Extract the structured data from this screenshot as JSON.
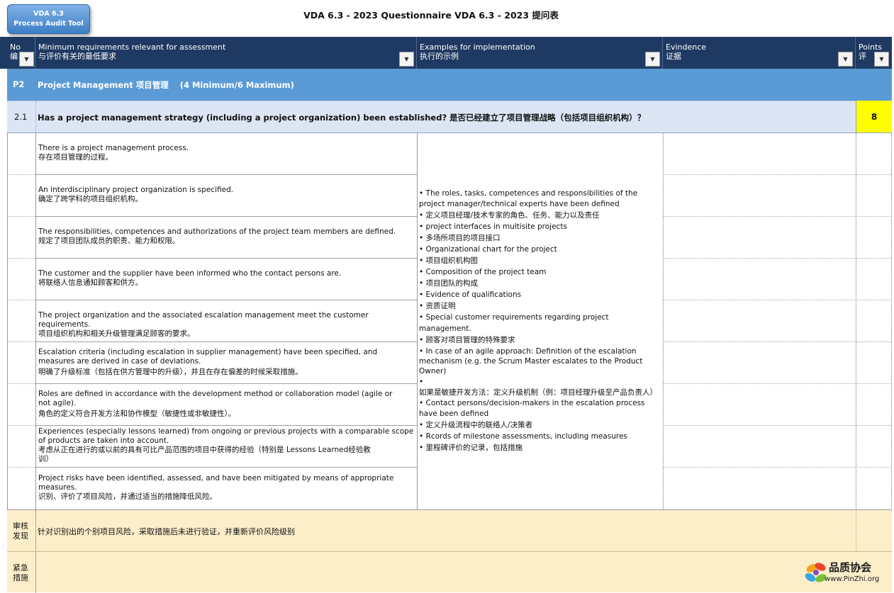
{
  "app": {
    "brand_line1": "VDA 6.3",
    "brand_line2": "Process Audit Tool",
    "title": "VDA 6.3 - 2023 Questionnaire  VDA 6.3 - 2023 提问表"
  },
  "header": {
    "no": {
      "line1": "No",
      "line2": "编"
    },
    "requirements": {
      "line1": "Minimum requirements relevant for assessment",
      "line2": "与评价有关的最低要求"
    },
    "examples": {
      "line1": "Examples for implementation",
      "line2": "执行的示例"
    },
    "evidence": {
      "line1": "Evindence",
      "line2": "证据"
    },
    "points": {
      "line1": "Points",
      "line2": "评"
    }
  },
  "section": {
    "code": "P2",
    "title": "Project Management 项目管理    (4 Minimum/6 Maximum)"
  },
  "question": {
    "number": "2.1",
    "text": "Has a project management strategy (including a project organization) been established? 是否已经建立了项目管理战略（包括项目组织机构）？",
    "points": "8"
  },
  "requirements": [
    {
      "en": "There is a project management process.",
      "zh": "存在项目管理的过程。"
    },
    {
      "en": "An interdisciplinary project organization is specified.",
      "zh": "确定了跨学科的项目组织机构。"
    },
    {
      "en": "The responsibilities, competences and authorizations of the project team members are defined.",
      "zh": "规定了项目团队成员的职责、能力和权限。"
    },
    {
      "en": "The customer and the supplier have been informed who the contact persons are.",
      "zh": "将联络人信息通知顾客和供方。"
    },
    {
      "en": "The project organization and the associated escalation management meet the customer requirements.",
      "zh": "项目组织机构和相关升级管理满足顾客的要求。"
    },
    {
      "en": "Escalation criteria (including escalation in supplier management) have been specified, and measures are derived in case of deviations.",
      "zh": "明确了升级标准（包括在供方管理中的升级），并且在存在偏差的时候采取措施。"
    },
    {
      "en": "Roles are defined in accordance with the development method or collaboration model (agile or not agile).",
      "zh": "角色的定义符合开发方法和协作模型（敏捷性或非敏捷性）。"
    },
    {
      "en": "Experiences (especially lessons learned) from ongoing or previous projects with a comparable scope of products are taken into account.",
      "zh": "考虑从正在进行的或以前的具有可比产品范围的项目中获得的经验（特别是 Lessons Learned经验教训）"
    },
    {
      "en": "Project risks have been identified, assessed, and have been mitigated by means of appropriate measures.",
      "zh": "识别、评价了项目风险，并通过适当的措施降低风险。"
    }
  ],
  "examples": [
    "• The roles, tasks, competences and responsibilities of the project manager/technical experts have been defined",
    "• 定义项目经理/技术专家的角色、任务、能力以及责任",
    "• project interfaces in multisite projects",
    "• 多场所项目的项目接口",
    "• Organizational chart for the project",
    "• 项目组织机构图",
    "• Composition of the project team",
    "• 项目团队的构成",
    "• Evidence of qualifications",
    "• 资质证明",
    "• Special customer requirements regarding project management.",
    "• 顾客对项目管理的特殊要求",
    "• In case of an agile approach: Definition of the escalation mechanism (e.g. the Scrum Master escalates to the Product Owner)",
    "•",
    "如果是敏捷开发方法：定义升级机制（例：项目经理升级至产品负责人）",
    "• Contact persons/decision-makers in the escalation process have been defined",
    "• 定义升级流程中的联络人/决策者",
    "• Rcords of milestone assessments, including measures",
    "• 里程碑评价的记录，包括措施"
  ],
  "findings": {
    "label": "审核发现",
    "text": "针对识别出的个别项目风险，采取措施后未进行验证，并重新评价风险级别"
  },
  "urgent": {
    "label": "紧急措施",
    "text": ""
  },
  "logo": {
    "name_zh": "品质协会",
    "url": "www.PinZhi.org"
  },
  "colors": {
    "header_bg": "#1f3a62",
    "section_bg": "#5b9bd5",
    "question_bg": "#dbe5f4",
    "points_bg": "#ffff00",
    "findings_bg": "#fdeeca"
  }
}
